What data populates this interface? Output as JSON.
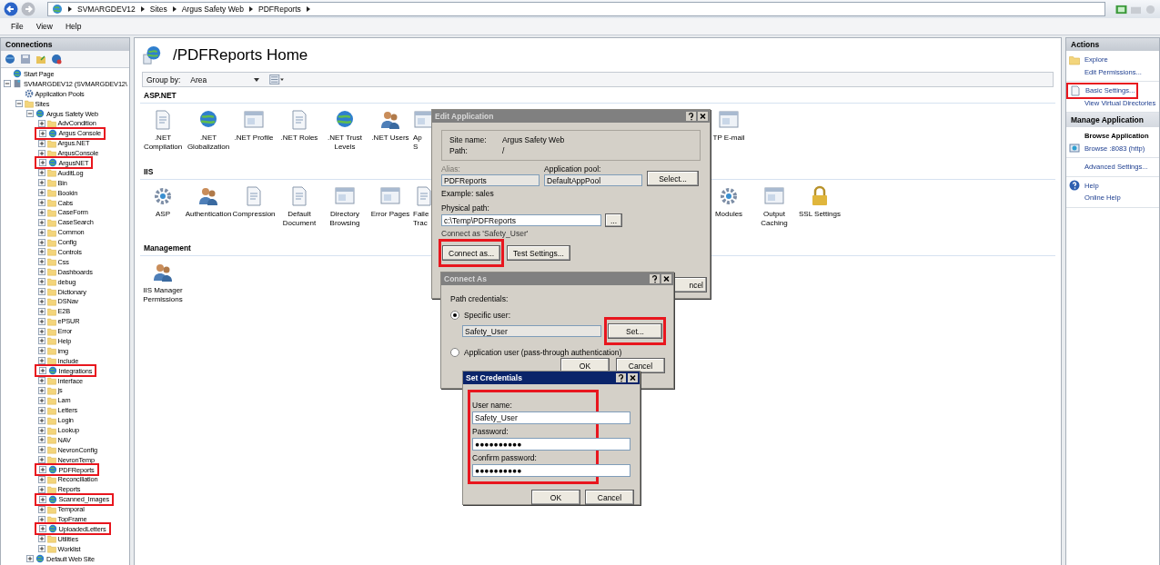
{
  "address_bar": {
    "breadcrumb": [
      "SVMARGDEV12",
      "Sites",
      "Argus Safety Web",
      "PDFReports"
    ]
  },
  "menu": [
    "File",
    "View",
    "Help"
  ],
  "connections": {
    "title": "Connections",
    "tree": [
      {
        "label": "Start Page",
        "kind": "page"
      },
      {
        "label": "SVMARGDEV12 (SVMARGDEV12\\",
        "kind": "server",
        "expanded": true,
        "children": [
          {
            "label": "Application Pools",
            "kind": "pools"
          },
          {
            "label": "Sites",
            "kind": "sites",
            "expanded": true,
            "children": [
              {
                "label": "Argus Safety Web",
                "kind": "site",
                "expanded": true,
                "children": [
                  {
                    "label": "AdvCondition",
                    "kind": "folder",
                    "expanded": false,
                    "highlighted": false
                  },
                  {
                    "label": "Argus Console",
                    "kind": "app",
                    "expanded": false,
                    "highlighted": true
                  },
                  {
                    "label": "Argus.NET",
                    "kind": "folder",
                    "expanded": false,
                    "highlighted": false
                  },
                  {
                    "label": "ArgusConsole",
                    "kind": "folder",
                    "expanded": false,
                    "highlighted": false
                  },
                  {
                    "label": "ArgusNET",
                    "kind": "app",
                    "expanded": false,
                    "highlighted": true
                  },
                  {
                    "label": "AuditLog",
                    "kind": "folder",
                    "expanded": false,
                    "highlighted": false
                  },
                  {
                    "label": "Bin",
                    "kind": "folder",
                    "expanded": false,
                    "highlighted": false
                  },
                  {
                    "label": "Bookin",
                    "kind": "folder",
                    "expanded": false,
                    "highlighted": false
                  },
                  {
                    "label": "Cabs",
                    "kind": "folder",
                    "expanded": false,
                    "highlighted": false
                  },
                  {
                    "label": "CaseForm",
                    "kind": "folder",
                    "expanded": false,
                    "highlighted": false
                  },
                  {
                    "label": "CaseSearch",
                    "kind": "folder",
                    "expanded": false,
                    "highlighted": false
                  },
                  {
                    "label": "Common",
                    "kind": "folder",
                    "expanded": false,
                    "highlighted": false
                  },
                  {
                    "label": "Config",
                    "kind": "folder",
                    "expanded": false,
                    "highlighted": false
                  },
                  {
                    "label": "Controls",
                    "kind": "folder",
                    "expanded": false,
                    "highlighted": false
                  },
                  {
                    "label": "Css",
                    "kind": "folder",
                    "expanded": false,
                    "highlighted": false
                  },
                  {
                    "label": "Dashboards",
                    "kind": "folder",
                    "expanded": false,
                    "highlighted": false
                  },
                  {
                    "label": "debug",
                    "kind": "folder",
                    "expanded": false,
                    "highlighted": false
                  },
                  {
                    "label": "Dictionary",
                    "kind": "folder",
                    "expanded": false,
                    "highlighted": false
                  },
                  {
                    "label": "DSNav",
                    "kind": "folder",
                    "expanded": false,
                    "highlighted": false
                  },
                  {
                    "label": "E2B",
                    "kind": "folder",
                    "expanded": false,
                    "highlighted": false
                  },
                  {
                    "label": "ePSUR",
                    "kind": "folder",
                    "expanded": false,
                    "highlighted": false
                  },
                  {
                    "label": "Error",
                    "kind": "folder",
                    "expanded": false,
                    "highlighted": false
                  },
                  {
                    "label": "Help",
                    "kind": "folder",
                    "expanded": false,
                    "highlighted": false
                  },
                  {
                    "label": "img",
                    "kind": "folder",
                    "expanded": false,
                    "highlighted": false
                  },
                  {
                    "label": "Include",
                    "kind": "folder",
                    "expanded": false,
                    "highlighted": false
                  },
                  {
                    "label": "Integrations",
                    "kind": "app",
                    "expanded": false,
                    "highlighted": true
                  },
                  {
                    "label": "Interface",
                    "kind": "folder",
                    "expanded": false,
                    "highlighted": false
                  },
                  {
                    "label": "js",
                    "kind": "folder",
                    "expanded": false,
                    "highlighted": false
                  },
                  {
                    "label": "Lam",
                    "kind": "folder",
                    "expanded": false,
                    "highlighted": false
                  },
                  {
                    "label": "Letters",
                    "kind": "folder",
                    "expanded": false,
                    "highlighted": false
                  },
                  {
                    "label": "Login",
                    "kind": "folder",
                    "expanded": false,
                    "highlighted": false
                  },
                  {
                    "label": "Lookup",
                    "kind": "folder",
                    "expanded": false,
                    "highlighted": false
                  },
                  {
                    "label": "NAV",
                    "kind": "folder",
                    "expanded": false,
                    "highlighted": false
                  },
                  {
                    "label": "NevronConfig",
                    "kind": "folder",
                    "expanded": false,
                    "highlighted": false
                  },
                  {
                    "label": "NevronTemp",
                    "kind": "folder",
                    "expanded": false,
                    "highlighted": false
                  },
                  {
                    "label": "PDFReports",
                    "kind": "app",
                    "expanded": false,
                    "highlighted": true
                  },
                  {
                    "label": "Reconciliation",
                    "kind": "folder",
                    "expanded": false,
                    "highlighted": false
                  },
                  {
                    "label": "Reports",
                    "kind": "folder",
                    "expanded": false,
                    "highlighted": false
                  },
                  {
                    "label": "Scanned_Images",
                    "kind": "app",
                    "expanded": false,
                    "highlighted": true
                  },
                  {
                    "label": "Temporal",
                    "kind": "folder",
                    "expanded": false,
                    "highlighted": false
                  },
                  {
                    "label": "TopFrame",
                    "kind": "folder",
                    "expanded": false,
                    "highlighted": false
                  },
                  {
                    "label": "UploadedLetters",
                    "kind": "app",
                    "expanded": false,
                    "highlighted": true
                  },
                  {
                    "label": "Utilities",
                    "kind": "folder",
                    "expanded": false,
                    "highlighted": false
                  },
                  {
                    "label": "Worklist",
                    "kind": "folder",
                    "expanded": false,
                    "highlighted": false
                  }
                ]
              },
              {
                "label": "Default Web Site",
                "kind": "site",
                "expanded": false
              }
            ]
          }
        ]
      }
    ]
  },
  "content": {
    "title": "/PDFReports Home",
    "group_by": {
      "label": "Group by:",
      "value": "Area"
    },
    "sections": [
      {
        "title": "ASP.NET",
        "features": [
          {
            "lines": [
              ".NET",
              "Compilation"
            ]
          },
          {
            "lines": [
              ".NET",
              "Globalization"
            ]
          },
          {
            "lines": [
              ".NET Profile"
            ]
          },
          {
            "lines": [
              ".NET Roles"
            ]
          },
          {
            "lines": [
              ".NET Trust",
              "Levels"
            ]
          },
          {
            "lines": [
              ".NET Users"
            ]
          },
          {
            "lines": [
              "Ap",
              "S"
            ]
          }
        ],
        "features_right": [
          {
            "lines": [
              "TP E-mail"
            ]
          }
        ]
      },
      {
        "title": "IIS",
        "features": [
          {
            "lines": [
              "ASP"
            ]
          },
          {
            "lines": [
              "Authentication"
            ]
          },
          {
            "lines": [
              "Compression"
            ]
          },
          {
            "lines": [
              "Default",
              "Document"
            ]
          },
          {
            "lines": [
              "Directory",
              "Browsing"
            ]
          },
          {
            "lines": [
              "Error Pages"
            ]
          },
          {
            "lines": [
              "Faile",
              "Trac"
            ]
          }
        ],
        "features_right": [
          {
            "lines": [
              "Modules"
            ]
          },
          {
            "lines": [
              "Output",
              "Caching"
            ]
          },
          {
            "lines": [
              "SSL Settings"
            ]
          }
        ]
      },
      {
        "title": "Management",
        "features": [
          {
            "lines": [
              "IIS Manager",
              "Permissions"
            ]
          }
        ]
      }
    ]
  },
  "actions": {
    "title": "Actions",
    "groups": [
      {
        "items": [
          {
            "label": "Explore",
            "kind": "link",
            "highlighted": false
          },
          {
            "label": "Edit Permissions...",
            "kind": "link",
            "highlighted": false
          }
        ]
      },
      {
        "items": [
          {
            "label": "Basic Settings...",
            "kind": "link",
            "highlighted": true
          },
          {
            "label": "View Virtual Directories",
            "kind": "link",
            "highlighted": false
          }
        ]
      },
      {
        "title": "Manage Application",
        "items": [
          {
            "label": "Browse Application",
            "kind": "heading",
            "highlighted": false
          },
          {
            "label": "Browse :8083 (http)",
            "kind": "link",
            "highlighted": false
          }
        ]
      },
      {
        "items": [
          {
            "label": "Advanced Settings...",
            "kind": "link",
            "highlighted": false
          }
        ]
      },
      {
        "items": [
          {
            "label": "Help",
            "kind": "link",
            "highlighted": false
          },
          {
            "label": "Online Help",
            "kind": "link",
            "highlighted": false
          }
        ]
      }
    ]
  },
  "edit_application": {
    "title": "Edit Application",
    "active": false,
    "site_name_label": "Site name:",
    "site_name": "Argus Safety Web",
    "path_label": "Path:",
    "path": "/",
    "alias_label": "Alias:",
    "alias": "PDFReports",
    "pool_label": "Application pool:",
    "pool": "DefaultAppPool",
    "select_button": "Select...",
    "example": "Example: sales",
    "physical_path_label": "Physical path:",
    "physical_path": "c:\\Temp\\PDFReports",
    "browse_button": "...",
    "connect_note": "Connect as 'Safety_User'",
    "connect_button": {
      "label": "Connect as...",
      "highlighted": true
    },
    "test_button": "Test Settings...",
    "cancel_button": "ncel"
  },
  "connect_as": {
    "title": "Connect As",
    "active": false,
    "heading": "Path credentials:",
    "options": [
      {
        "label": "Specific user:",
        "selected": true
      },
      {
        "label": "Application user (pass-through authentication)",
        "selected": false
      }
    ],
    "user": "Safety_User",
    "set_button": {
      "label": "Set...",
      "highlighted": true
    },
    "buttons": [
      "OK",
      "Cancel"
    ]
  },
  "set_credentials": {
    "title": "Set Credentials",
    "active": true,
    "highlighted": true,
    "fields": [
      {
        "label": "User name:",
        "value": "Safety_User"
      },
      {
        "label": "Password:",
        "value": "●●●●●●●●●●"
      },
      {
        "label": "Confirm password:",
        "value": "●●●●●●●●●●"
      }
    ],
    "buttons": [
      "OK",
      "Cancel"
    ]
  }
}
